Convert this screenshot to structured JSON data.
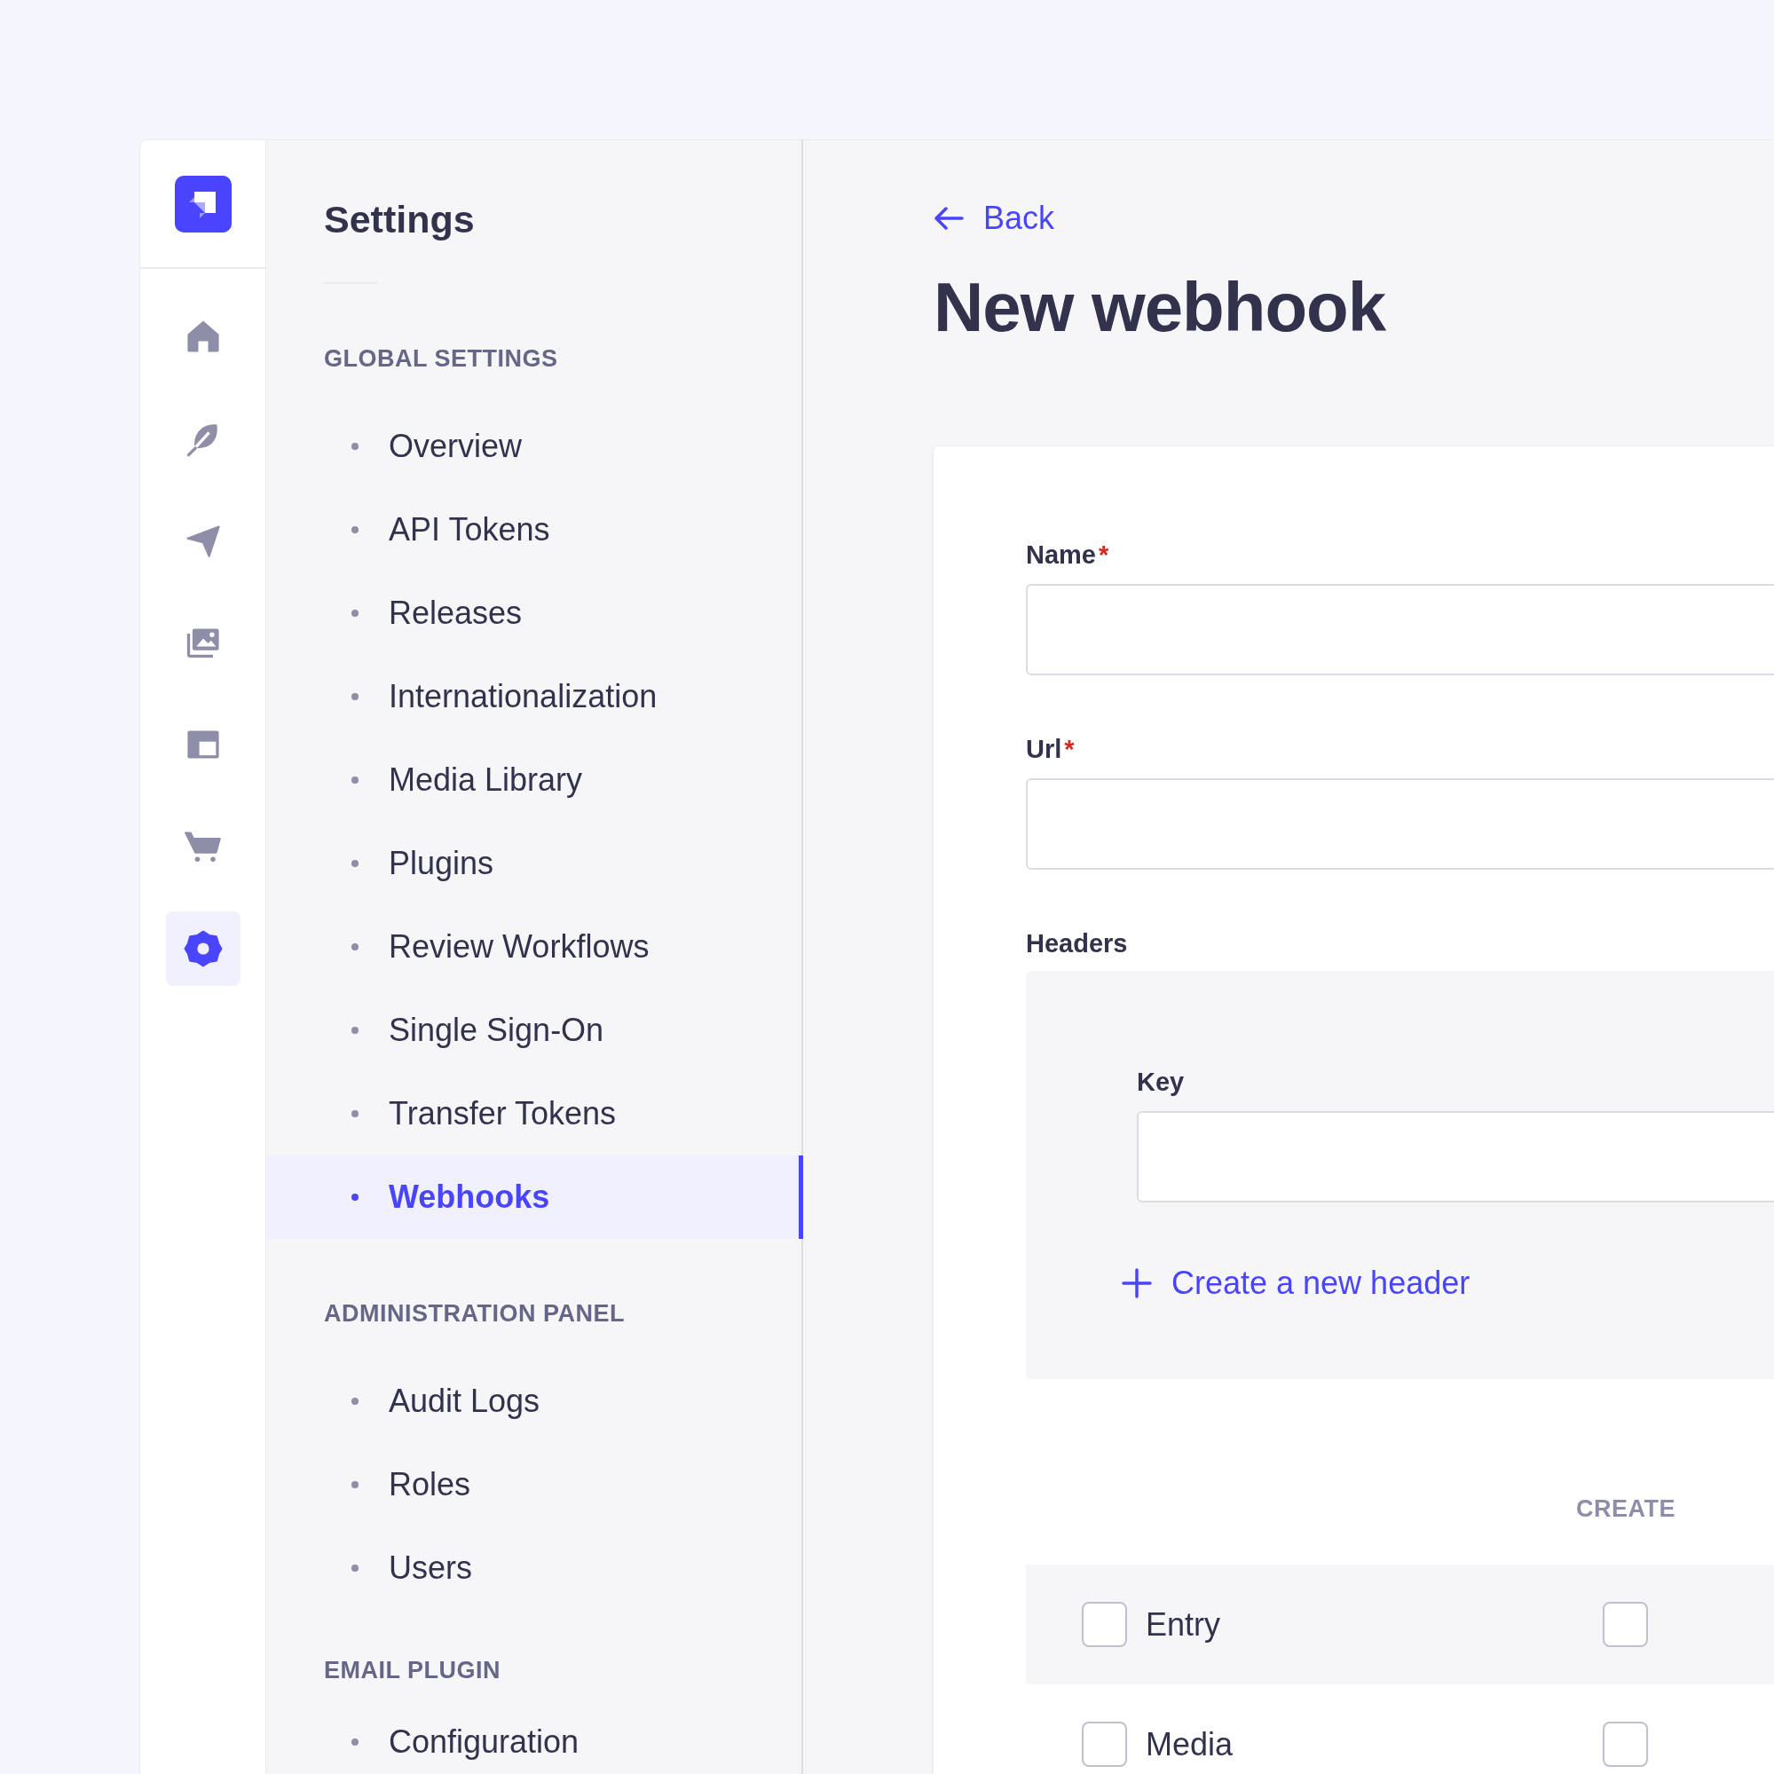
{
  "rail": {
    "items": [
      {
        "kind": "home",
        "selected": false
      },
      {
        "kind": "feather",
        "selected": false
      },
      {
        "kind": "send",
        "selected": false
      },
      {
        "kind": "images",
        "selected": false
      },
      {
        "kind": "layout",
        "selected": false
      },
      {
        "kind": "cart",
        "selected": false
      },
      {
        "kind": "gear",
        "selected": true
      }
    ]
  },
  "settings_nav": {
    "title": "Settings",
    "sections": [
      {
        "heading": "GLOBAL SETTINGS",
        "items": [
          {
            "label": "Overview",
            "selected": false
          },
          {
            "label": "API Tokens",
            "selected": false
          },
          {
            "label": "Releases",
            "selected": false
          },
          {
            "label": "Internationalization",
            "selected": false
          },
          {
            "label": "Media Library",
            "selected": false
          },
          {
            "label": "Plugins",
            "selected": false
          },
          {
            "label": "Review Workflows",
            "selected": false
          },
          {
            "label": "Single Sign-On",
            "selected": false
          },
          {
            "label": "Transfer Tokens",
            "selected": false
          },
          {
            "label": "Webhooks",
            "selected": true
          }
        ]
      },
      {
        "heading": "ADMINISTRATION PANEL",
        "items": [
          {
            "label": "Audit Logs",
            "selected": false
          },
          {
            "label": "Roles",
            "selected": false
          },
          {
            "label": "Users",
            "selected": false
          }
        ]
      },
      {
        "heading": "EMAIL PLUGIN",
        "items": [
          {
            "label": "Configuration",
            "selected": false
          }
        ]
      }
    ]
  },
  "main": {
    "back_link": "Back",
    "title": "New webhook",
    "fields": [
      {
        "label": "Name",
        "required_mark": "*"
      },
      {
        "label": "Url",
        "required_mark": "*"
      }
    ],
    "headers": {
      "label": "Headers",
      "key_label": "Key",
      "add_link": "Create a new header"
    },
    "events": {
      "columns": [
        "CREATE"
      ],
      "rows": [
        {
          "label": "Entry",
          "checked": false,
          "create_checked": false
        },
        {
          "label": "Media",
          "checked": false,
          "create_checked": false
        }
      ]
    }
  }
}
